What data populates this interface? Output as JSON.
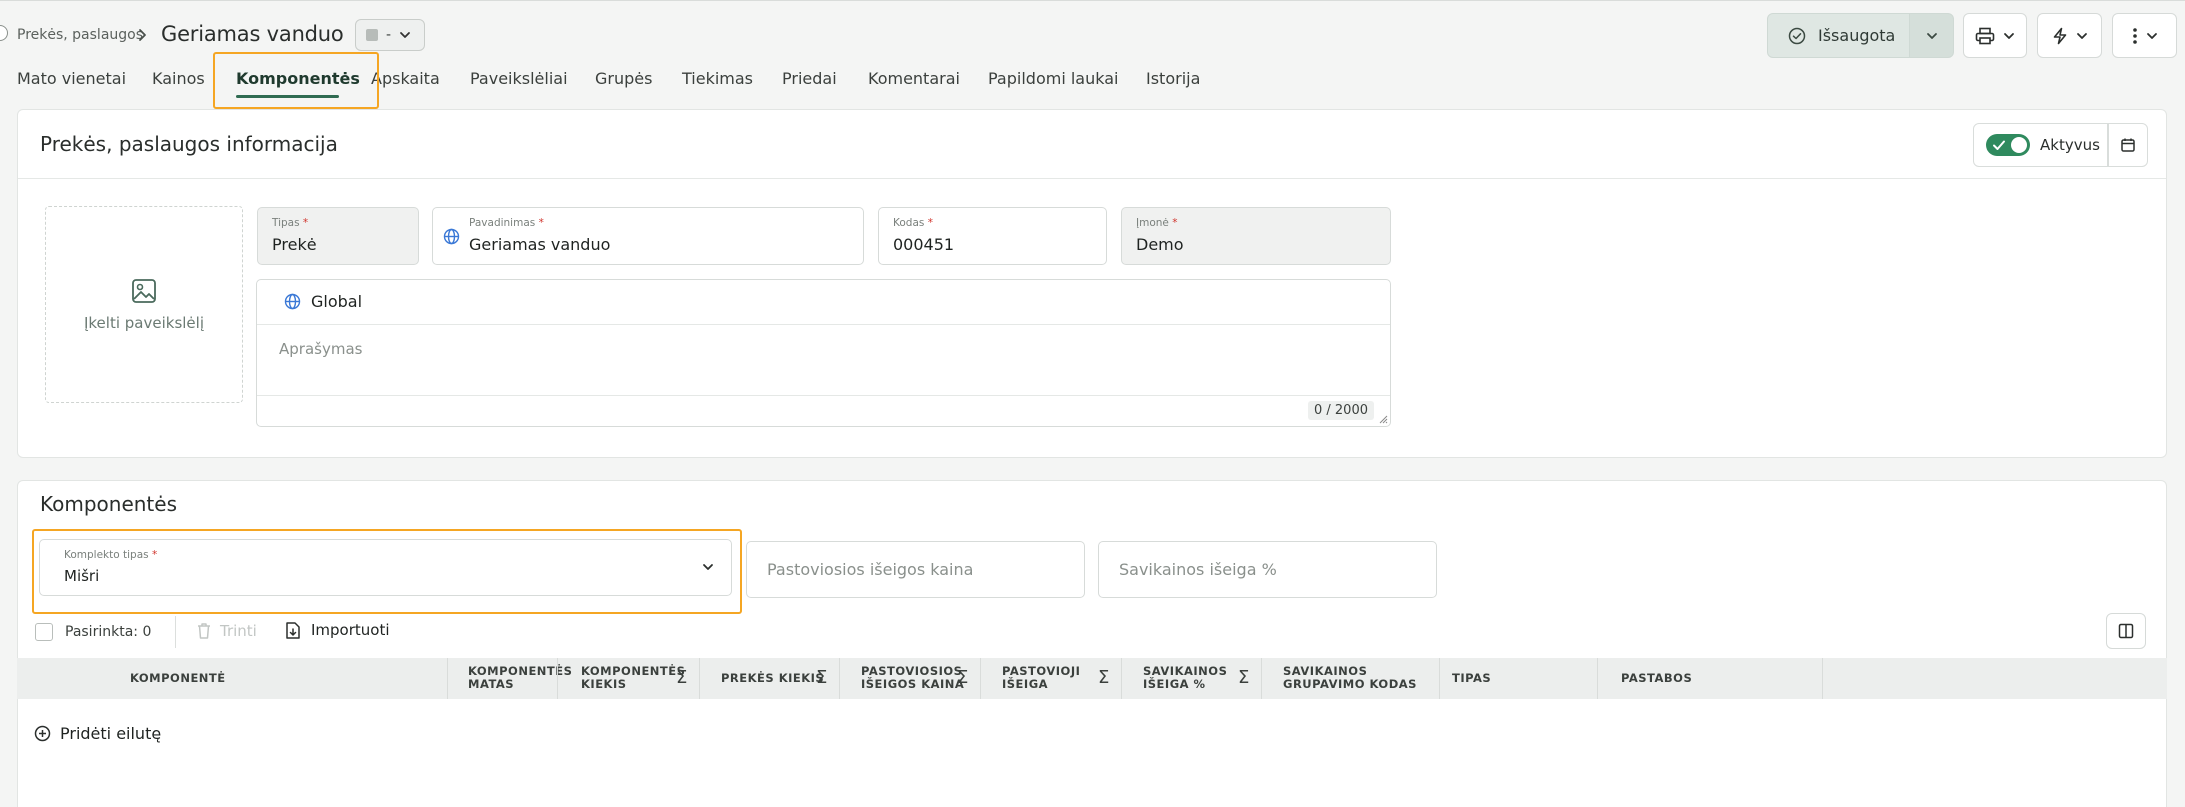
{
  "breadcrumb": {
    "parent": "Prekės, paslaugos",
    "current": "Geriamas vanduo"
  },
  "status_select": {
    "value": "-"
  },
  "header_actions": {
    "saved_label": "Išsaugota"
  },
  "tabs": [
    {
      "label": "Mato vienetai"
    },
    {
      "label": "Kainos"
    },
    {
      "label": "Komponentės",
      "active": true
    },
    {
      "label": "Apskaita"
    },
    {
      "label": "Paveikslėliai"
    },
    {
      "label": "Grupės"
    },
    {
      "label": "Tiekimas"
    },
    {
      "label": "Priedai"
    },
    {
      "label": "Komentarai"
    },
    {
      "label": "Papildomi laukai"
    },
    {
      "label": "Istorija"
    }
  ],
  "info_card": {
    "title": "Prekės, paslaugos informacija",
    "active_label": "Aktyvus",
    "upload_label": "Įkelti paveikslėlį",
    "fields": {
      "type": {
        "label": "Tipas",
        "value": "Prekė"
      },
      "name": {
        "label": "Pavadinimas",
        "value": "Geriamas vanduo"
      },
      "code": {
        "label": "Kodas",
        "value": "000451"
      },
      "company": {
        "label": "Įmonė",
        "value": "Demo"
      }
    },
    "language": "Global",
    "description_placeholder": "Aprašymas",
    "counter": "0 / 2000"
  },
  "components_card": {
    "title": "Komponentės",
    "kit_type": {
      "label": "Komplekto tipas",
      "value": "Mišri"
    },
    "fixed_output_price_placeholder": "Pastoviosios išeigos kaina",
    "cost_output_placeholder": "Savikainos išeiga %",
    "selected_label": "Pasirinkta: 0",
    "delete_label": "Trinti",
    "import_label": "Importuoti",
    "columns": {
      "component": "KOMPONENTĖ",
      "unit_1": "KOMPONENTĖS",
      "unit_2": "MATAS",
      "qty_1": "KOMPONENTĖS",
      "qty_2": "KIEKIS",
      "product_qty": "PREKĖS KIEKIS",
      "fixed_price_1": "PASTOVIOSIOS",
      "fixed_price_2": "IŠEIGOS KAINA",
      "fixed_output_1": "PASTOVIOJI",
      "fixed_output_2": "IŠEIGA",
      "cost_pct_1": "SAVIKAINOS",
      "cost_pct_2": "IŠEIGA %",
      "cost_group_1": "SAVIKAINOS",
      "cost_group_2": "GRUPAVIMO KODAS",
      "type": "TIPAS",
      "notes": "PASTABOS"
    },
    "add_row_label": "Pridėti eilutę"
  },
  "colors": {
    "accent": "#2f6b51",
    "highlight": "#f5a623",
    "toggle": "#2f8a5e"
  }
}
